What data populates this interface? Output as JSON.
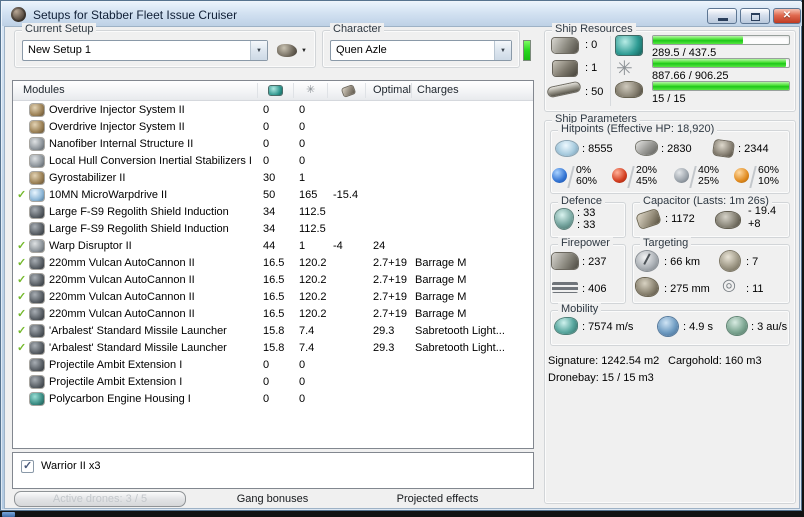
{
  "window": {
    "title": "Setups for Stabber Fleet Issue Cruiser"
  },
  "glyphs": {
    "check": "✓",
    "checkbox_check": "✓",
    "dropdown_arrow": "▼",
    "close": "✕",
    "atom": "✳",
    "sensor_strength": "◎"
  },
  "colors": {
    "progress_green": "#2fd42a",
    "character_status_green": "#27d81e",
    "checkmark_green": "#74b92c",
    "close_button_red": "#bf3a22"
  },
  "setup": {
    "label": "Current Setup",
    "value": "New Setup 1"
  },
  "character": {
    "label": "Character",
    "value": "Quen Azle"
  },
  "modules": {
    "title": "Modules",
    "col_icons": [
      "cpu-icon",
      "powergrid-icon",
      "capacitor-icon"
    ],
    "col_optimal": "Optimal",
    "col_charges": "Charges",
    "rows": [
      {
        "active": false,
        "icon": "tan",
        "name": "Overdrive Injector System II",
        "cpu": "0",
        "pg": "0",
        "cap": "",
        "optimal": "",
        "charge": ""
      },
      {
        "active": false,
        "icon": "tan",
        "name": "Overdrive Injector System II",
        "cpu": "0",
        "pg": "0",
        "cap": "",
        "optimal": "",
        "charge": ""
      },
      {
        "active": false,
        "icon": "gray",
        "name": "Nanofiber Internal Structure II",
        "cpu": "0",
        "pg": "0",
        "cap": "",
        "optimal": "",
        "charge": ""
      },
      {
        "active": false,
        "icon": "gray",
        "name": "Local Hull Conversion Inertial Stabilizers I",
        "cpu": "0",
        "pg": "0",
        "cap": "",
        "optimal": "",
        "charge": ""
      },
      {
        "active": false,
        "icon": "tan",
        "name": "Gyrostabilizer II",
        "cpu": "30",
        "pg": "1",
        "cap": "",
        "optimal": "",
        "charge": ""
      },
      {
        "active": true,
        "icon": "blue",
        "name": "10MN MicroWarpdrive II",
        "cpu": "50",
        "pg": "165",
        "cap": "-15.4",
        "optimal": "",
        "charge": ""
      },
      {
        "active": false,
        "icon": "dark",
        "name": "Large F-S9 Regolith Shield Induction",
        "cpu": "34",
        "pg": "112.5",
        "cap": "",
        "optimal": "",
        "charge": ""
      },
      {
        "active": false,
        "icon": "dark",
        "name": "Large F-S9 Regolith Shield Induction",
        "cpu": "34",
        "pg": "112.5",
        "cap": "",
        "optimal": "",
        "charge": ""
      },
      {
        "active": true,
        "icon": "gray",
        "name": "Warp Disruptor II",
        "cpu": "44",
        "pg": "1",
        "cap": "-4",
        "optimal": "24",
        "charge": ""
      },
      {
        "active": true,
        "icon": "dark",
        "name": "220mm Vulcan AutoCannon II",
        "cpu": "16.5",
        "pg": "120.2",
        "cap": "",
        "optimal": "2.7+19",
        "charge": "Barrage M"
      },
      {
        "active": true,
        "icon": "dark",
        "name": "220mm Vulcan AutoCannon II",
        "cpu": "16.5",
        "pg": "120.2",
        "cap": "",
        "optimal": "2.7+19",
        "charge": "Barrage M"
      },
      {
        "active": true,
        "icon": "dark",
        "name": "220mm Vulcan AutoCannon II",
        "cpu": "16.5",
        "pg": "120.2",
        "cap": "",
        "optimal": "2.7+19",
        "charge": "Barrage M"
      },
      {
        "active": true,
        "icon": "dark",
        "name": "220mm Vulcan AutoCannon II",
        "cpu": "16.5",
        "pg": "120.2",
        "cap": "",
        "optimal": "2.7+19",
        "charge": "Barrage M"
      },
      {
        "active": true,
        "icon": "dark",
        "name": "'Arbalest' Standard Missile Launcher",
        "cpu": "15.8",
        "pg": "7.4",
        "cap": "",
        "optimal": "29.3",
        "charge": "Sabretooth Light..."
      },
      {
        "active": true,
        "icon": "dark",
        "name": "'Arbalest' Standard Missile Launcher",
        "cpu": "15.8",
        "pg": "7.4",
        "cap": "",
        "optimal": "29.3",
        "charge": "Sabretooth Light..."
      },
      {
        "active": false,
        "icon": "dark",
        "name": "Projectile Ambit Extension I",
        "cpu": "0",
        "pg": "0",
        "cap": "",
        "optimal": "",
        "charge": ""
      },
      {
        "active": false,
        "icon": "dark",
        "name": "Projectile Ambit Extension I",
        "cpu": "0",
        "pg": "0",
        "cap": "",
        "optimal": "",
        "charge": ""
      },
      {
        "active": false,
        "icon": "teal",
        "name": "Polycarbon Engine Housing I",
        "cpu": "0",
        "pg": "0",
        "cap": "",
        "optimal": "",
        "charge": ""
      }
    ]
  },
  "drones_panel": {
    "items": [
      {
        "checked": true,
        "label": "Warrior II x3"
      }
    ]
  },
  "footer": {
    "active_drones": "Active drones: 3 / 5",
    "gang_bonuses": "Gang bonuses",
    "projected_effects": "Projected effects"
  },
  "ship_resources": {
    "title": "Ship Resources",
    "slots": [
      {
        "icon": "turret-hardpoints-icon",
        "value": ": 0"
      },
      {
        "icon": "launcher-hardpoints-icon",
        "value": ": 1"
      },
      {
        "icon": "calibration-icon",
        "value": ": 50"
      }
    ],
    "bars": [
      {
        "icon": "cpu-icon",
        "text": "289.5 / 437.5",
        "pct": 66
      },
      {
        "icon": "powergrid-icon",
        "text": "887.66 / 906.25",
        "pct": 98
      },
      {
        "icon": "drone-bandwidth-icon",
        "text": "15 / 15",
        "pct": 100
      }
    ]
  },
  "ship_parameters": {
    "title": "Ship Parameters",
    "hitpoints": {
      "title": "Hitpoints (Effective HP: 18,920)",
      "shield": ": 8555",
      "armor": ": 2830",
      "structure": ": 2344",
      "resists": [
        {
          "name": "em-resist-icon",
          "top": "0%",
          "bottom": "60%"
        },
        {
          "name": "thermal-resist-icon",
          "top": "20%",
          "bottom": "45%"
        },
        {
          "name": "kinetic-resist-icon",
          "top": "40%",
          "bottom": "25%"
        },
        {
          "name": "explosive-resist-icon",
          "top": "60%",
          "bottom": "10%"
        }
      ]
    },
    "defence": {
      "title": "Defence",
      "line1": ": 33",
      "line2": ": 33"
    },
    "capacitor": {
      "title": "Capacitor (Lasts: 1m 26s)",
      "amount": ": 1172",
      "delta_top": "- 19.4",
      "delta_bottom": "+8"
    },
    "firepower": {
      "title": "Firepower",
      "dps": ": 237",
      "volley": ": 406"
    },
    "targeting": {
      "title": "Targeting",
      "range": ": 66 km",
      "max_targets": ": 7",
      "scan_res": ": 275 mm",
      "sensor_strength": ": 11"
    },
    "mobility": {
      "title": "Mobility",
      "speed": ": 7574 m/s",
      "align": ": 4.9 s",
      "warp": ": 3 au/s"
    },
    "signature": "Signature: 1242.54 m2",
    "cargohold": "Cargohold: 160 m3",
    "dronebay": "Dronebay: 15 / 15 m3"
  }
}
